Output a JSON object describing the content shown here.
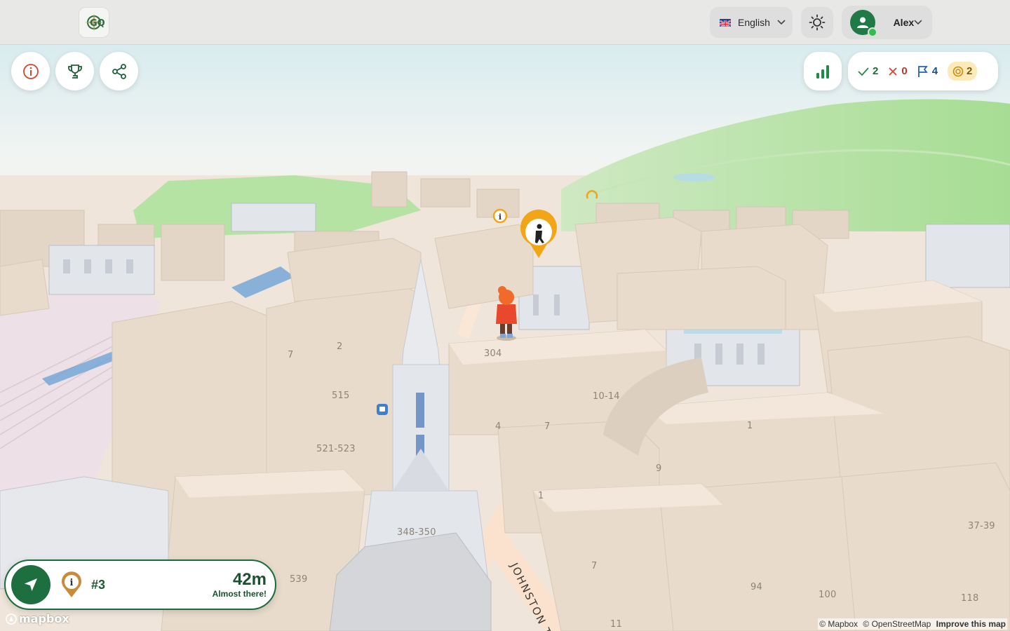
{
  "header": {
    "logo": {
      "text": "GQ",
      "icon": "compass-logo-icon"
    },
    "language": {
      "label": "English",
      "flag_icon": "uk-flag-icon"
    },
    "theme_icon": "sun-icon",
    "user": {
      "name": "Alex",
      "status": "online"
    }
  },
  "controls": {
    "info_icon": "info-icon",
    "trophy_icon": "trophy-icon",
    "share_icon": "share-icon",
    "stats_icon": "bar-chart-icon"
  },
  "score": {
    "correct": "2",
    "wrong": "0",
    "flags": "4",
    "coins": "2"
  },
  "map_labels": [
    {
      "text": "7",
      "name": "map-label-7a"
    },
    {
      "text": "2",
      "name": "map-label-2"
    },
    {
      "text": "304",
      "name": "map-label-304"
    },
    {
      "text": "515",
      "name": "map-label-515"
    },
    {
      "text": "10-14",
      "name": "map-label-10-14"
    },
    {
      "text": "4",
      "name": "map-label-4"
    },
    {
      "text": "7",
      "name": "map-label-7b"
    },
    {
      "text": "1",
      "name": "map-label-1a"
    },
    {
      "text": "521-523",
      "name": "map-label-521-523"
    },
    {
      "text": "9",
      "name": "map-label-9"
    },
    {
      "text": "1",
      "name": "map-label-1b"
    },
    {
      "text": "348-350",
      "name": "map-label-348-350"
    },
    {
      "text": "37-39",
      "name": "map-label-37-39"
    },
    {
      "text": "539",
      "name": "map-label-539"
    },
    {
      "text": "7",
      "name": "map-label-7c"
    },
    {
      "text": "94",
      "name": "map-label-94"
    },
    {
      "text": "100",
      "name": "map-label-100"
    },
    {
      "text": "118",
      "name": "map-label-118"
    },
    {
      "text": "11",
      "name": "map-label-11"
    }
  ],
  "street_label": "JOHNSTON T",
  "navigation": {
    "target_number": "#3",
    "distance": "42m",
    "status": "Almost there!"
  },
  "footer": {
    "mapbox_logo": "mapbox",
    "attribution": [
      "© Mapbox",
      "© OpenStreetMap"
    ],
    "improve_link": "Improve this map"
  },
  "colors": {
    "brand_green": "#1e6f3f",
    "marker_orange": "#f2a516",
    "building": "#e6d8c8",
    "park": "#a8dc95"
  }
}
